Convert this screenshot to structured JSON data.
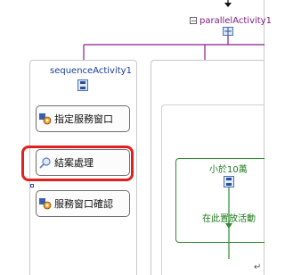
{
  "parallel": {
    "title": "parallelActivity1",
    "collapse_glyph": "−"
  },
  "sequence": {
    "title": "sequenceActivity1"
  },
  "activities": [
    {
      "label": "指定服務窗口",
      "icon": "code-activity-icon"
    },
    {
      "label": "結案處理",
      "icon": "search-activity-icon",
      "highlighted": true
    },
    {
      "label": "服務窗口確認",
      "icon": "code-activity-icon"
    }
  ],
  "branch": {
    "condition": "小於10萬",
    "drop_hint": "在此置放活動"
  },
  "paragraph_mark": "↵",
  "colors": {
    "connector_purple": "#8b1c8b",
    "connector_blue": "#1f2fa8",
    "connector_green": "#2e8b2e",
    "highlight_red": "#e02020"
  }
}
